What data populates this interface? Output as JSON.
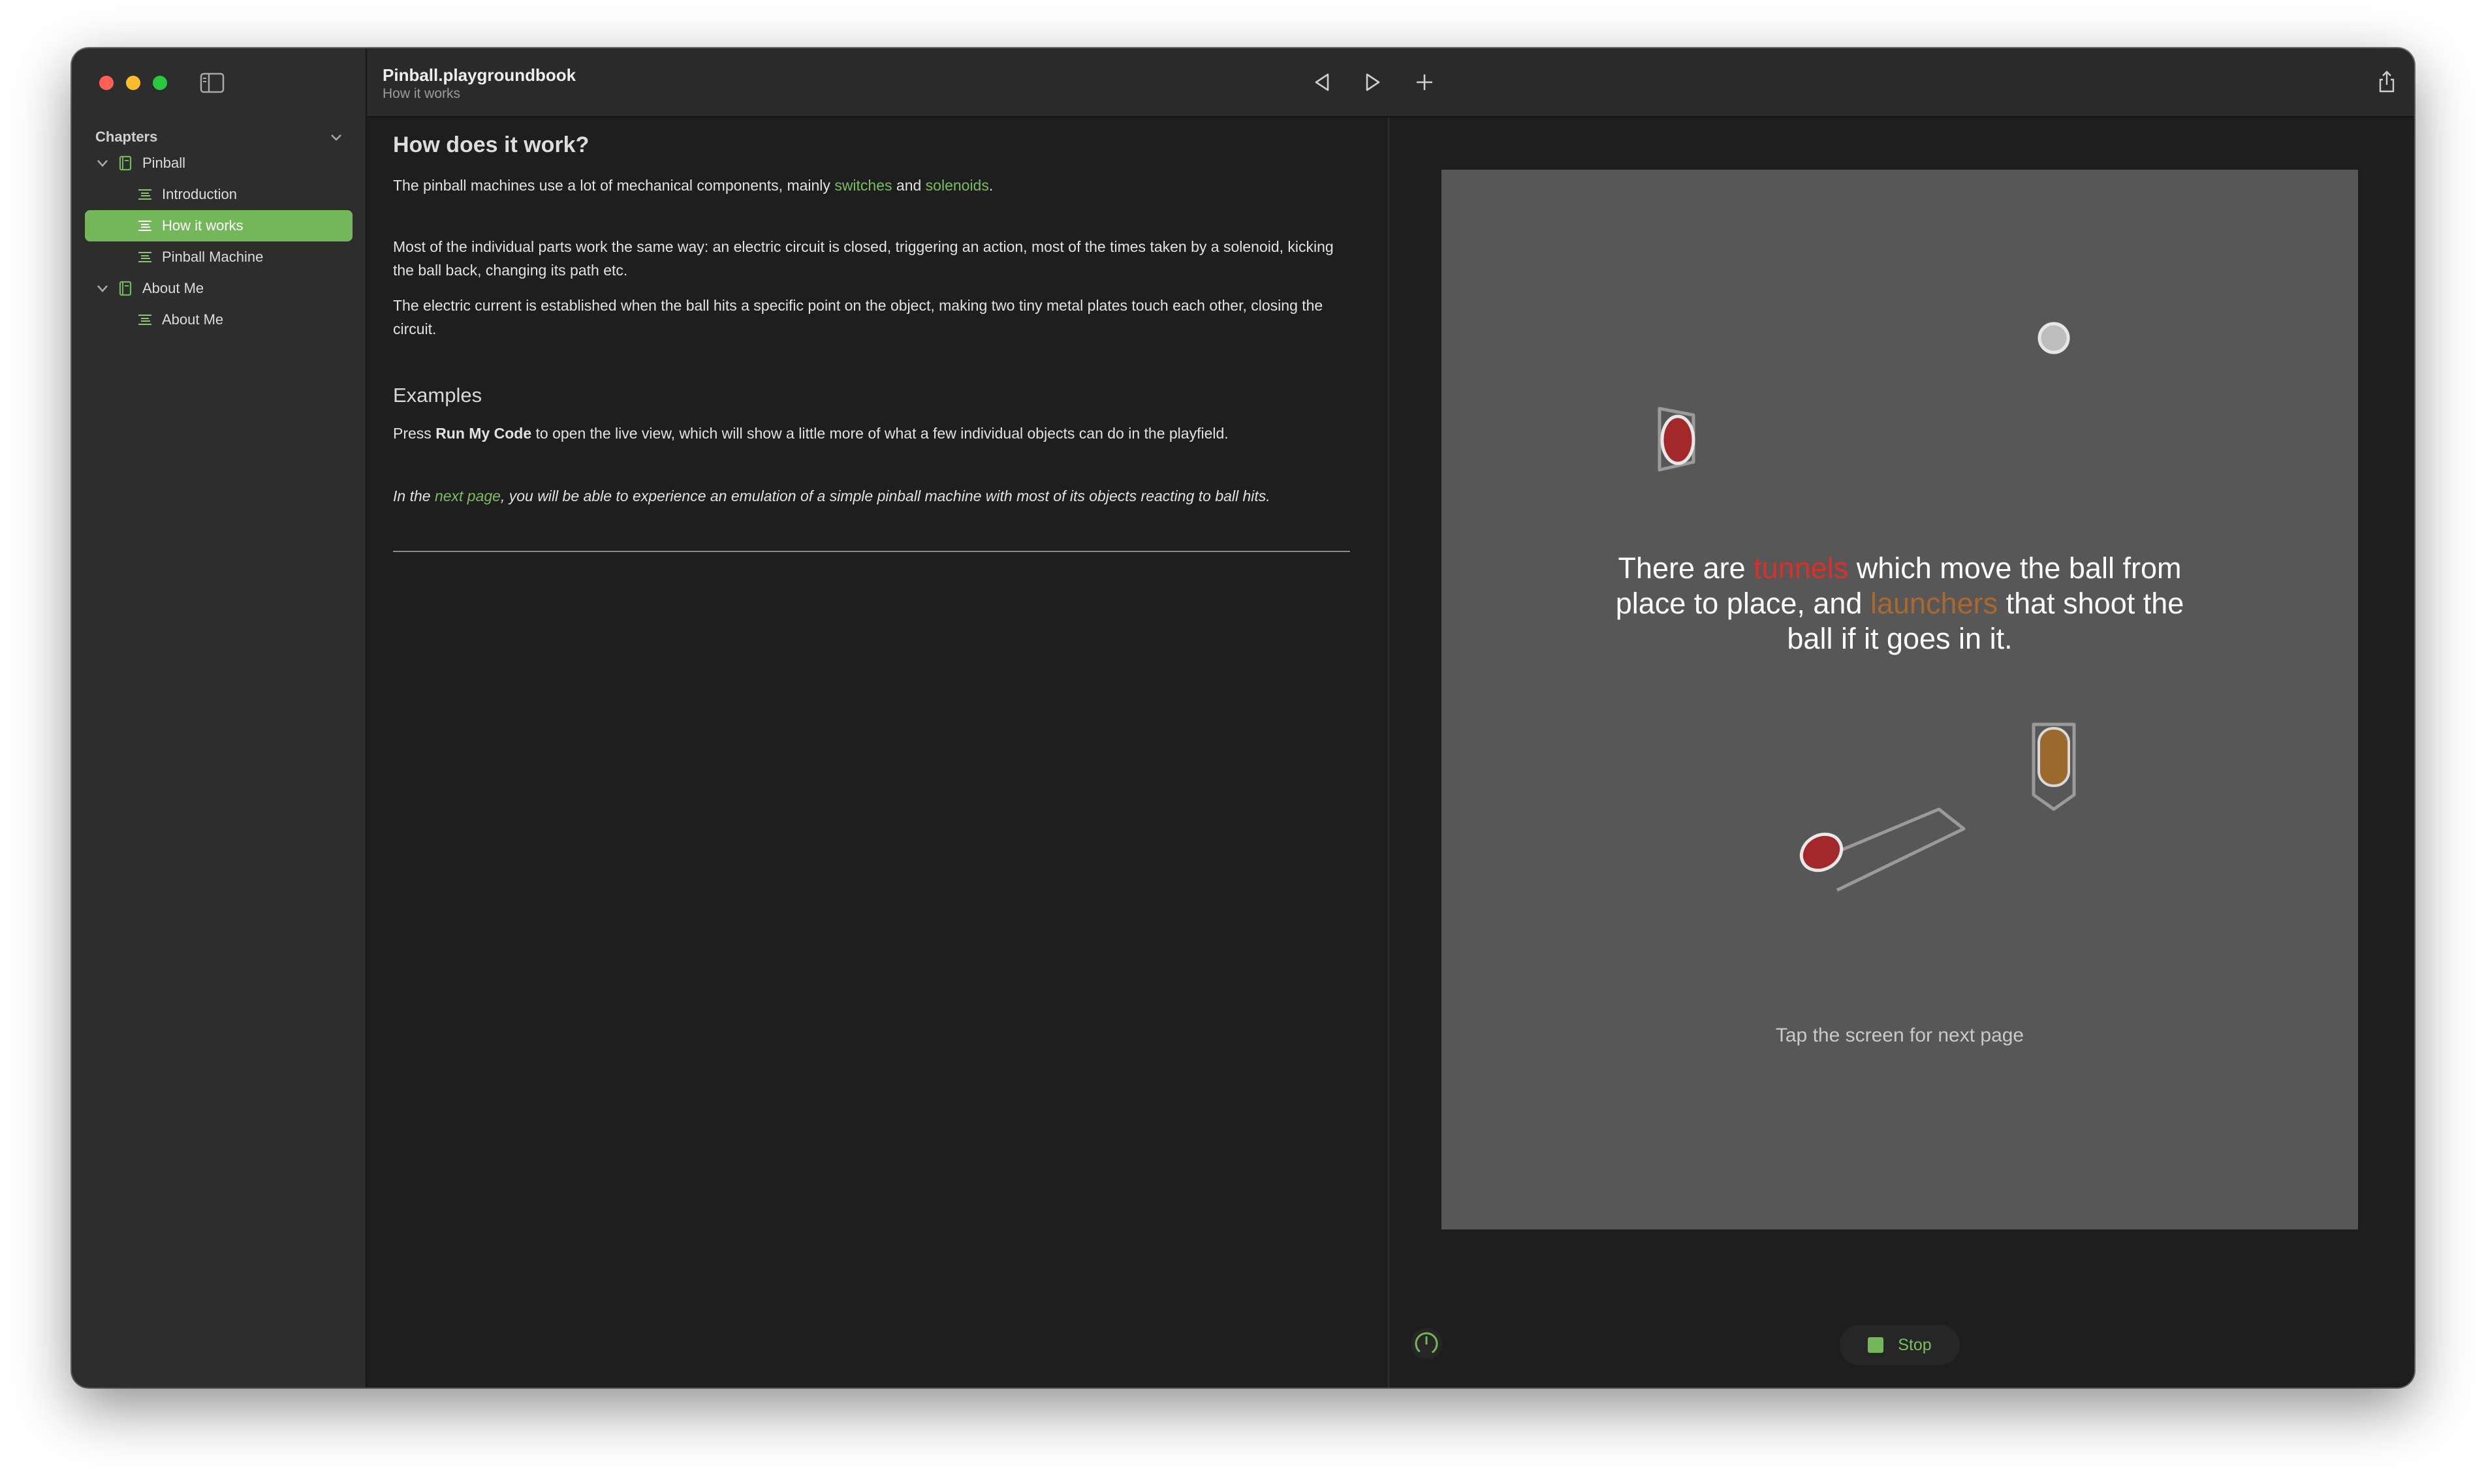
{
  "window": {
    "title": "Pinball.playgroundbook",
    "subtitle": "How it works"
  },
  "sidebar": {
    "header": "Chapters",
    "chapters": [
      {
        "label": "Pinball",
        "pages": [
          {
            "label": "Introduction",
            "selected": false
          },
          {
            "label": "How it works",
            "selected": true
          },
          {
            "label": "Pinball Machine",
            "selected": false
          }
        ]
      },
      {
        "label": "About Me",
        "pages": [
          {
            "label": "About Me",
            "selected": false
          }
        ]
      }
    ]
  },
  "toolbar": {
    "icons": [
      "back-icon",
      "run-icon",
      "add-icon",
      "share-icon"
    ]
  },
  "prose": {
    "heading": "How does it work?",
    "p1": {
      "before": "The pinball machines use a lot of mechanical components, mainly ",
      "link1": "switches",
      "mid": " and ",
      "link2": "solenoids",
      "after": "."
    },
    "p2": "Most of the individual parts work the same way: an electric circuit is closed, triggering an action, most of the times taken by a solenoid, kicking the ball back, changing its path etc.",
    "p3": "The electric current is established when the ball hits a specific point on the object, making two tiny metal plates touch each other, closing the circuit.",
    "examples_heading": "Examples",
    "p4": {
      "before": "Press ",
      "bold": "Run My Code",
      "after": " to open the live view, which will show a little more of what a few individual objects can do in the playfield."
    },
    "p5": {
      "before": "In the ",
      "link": "next page",
      "after": ", you will be able to experience an emulation of a simple pinball machine with most of its objects reacting to ball hits."
    }
  },
  "liveview": {
    "caption": {
      "part1": "There are ",
      "tunnels": "tunnels",
      "part2": " which move the ball from place to place, and ",
      "launchers": "launchers",
      "part3": " that shoot the ball if it goes in it."
    },
    "hint": "Tap the screen for next page",
    "stop_label": "Stop"
  },
  "colors": {
    "accent": "#74b75a",
    "tunnel": "#d9312a",
    "launcher": "#a8682e",
    "stage": "#575757"
  }
}
